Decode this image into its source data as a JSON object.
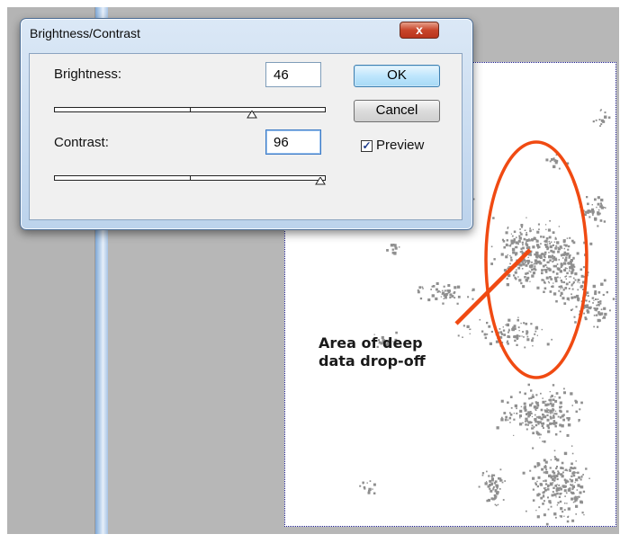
{
  "dialog": {
    "title": "Brightness/Contrast",
    "close_symbol": "x",
    "brightness": {
      "label": "Brightness:",
      "value": "46",
      "slider_fraction": 0.73
    },
    "contrast": {
      "label": "Contrast:",
      "value": "96",
      "slider_fraction": 0.98
    },
    "ok_label": "OK",
    "cancel_label": "Cancel",
    "preview": {
      "label": "Preview",
      "checked": true
    }
  },
  "annotation": {
    "line1": "Area of deep",
    "line2": "data drop-off",
    "color": "#f04a12"
  }
}
